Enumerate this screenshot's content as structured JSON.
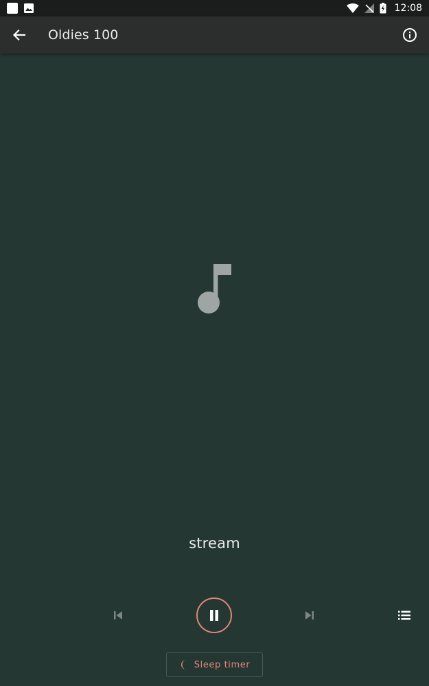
{
  "status_bar": {
    "time": "12:08"
  },
  "app_bar": {
    "title": "Oldies 100"
  },
  "now_playing": {
    "subtitle": "stream"
  },
  "sleep_timer": {
    "label": "Sleep timer"
  },
  "colors": {
    "background": "#253733",
    "app_bar": "#2b2e2d",
    "accent": "#e0877a",
    "artwork": "#9ea5a3"
  },
  "icons": {
    "back": "arrow-left-icon",
    "info": "info-circle-icon",
    "artwork": "music-note-icon",
    "previous": "skip-previous-icon",
    "pause": "pause-icon",
    "next": "skip-next-icon",
    "queue": "queue-list-icon",
    "sleep": "moon-icon"
  }
}
